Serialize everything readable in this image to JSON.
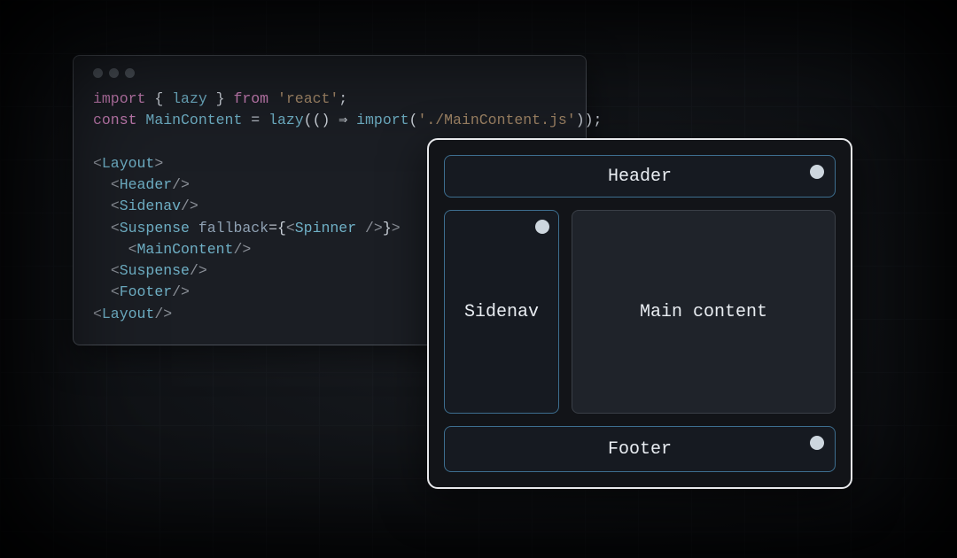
{
  "code": {
    "tokens": {
      "import": "import",
      "lbrace": "{",
      "lazy": "lazy",
      "rbrace": "}",
      "from": "from",
      "react": "'react'",
      "semi": ";",
      "const": "const",
      "MainContent": "MainContent",
      "eq": "=",
      "lazyCall": "lazy",
      "arrow": "(() ⇒ ",
      "importFn": "import",
      "mainContentPath": "'./MainContent.js'",
      "closeCall": "));",
      "Layout": "Layout",
      "Header": "Header",
      "Sidenav": "Sidenav",
      "Suspense": "Suspense",
      "fallback": "fallback",
      "Spinner": "Spinner",
      "Footer": "Footer"
    }
  },
  "diagram": {
    "header": "Header",
    "sidenav": "Sidenav",
    "main": "Main content",
    "footer": "Footer"
  }
}
